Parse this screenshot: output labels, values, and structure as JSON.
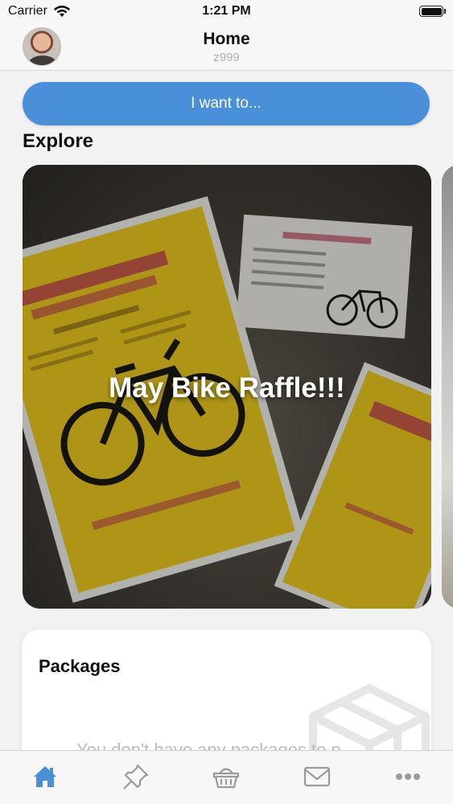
{
  "status_bar": {
    "carrier": "Carrier",
    "time": "1:21 PM"
  },
  "header": {
    "title": "Home",
    "subtitle": "z999"
  },
  "actions": {
    "want_label": "I want to..."
  },
  "explore": {
    "heading": "Explore",
    "cards": [
      {
        "title": "May Bike Raffle!!!"
      }
    ]
  },
  "packages": {
    "title": "Packages",
    "empty_text": "You don't have any packages to p"
  },
  "tabs": [
    {
      "name": "home",
      "icon": "home-icon",
      "active": true
    },
    {
      "name": "pin",
      "icon": "pin-icon",
      "active": false
    },
    {
      "name": "basket",
      "icon": "basket-icon",
      "active": false
    },
    {
      "name": "mail",
      "icon": "mail-icon",
      "active": false
    },
    {
      "name": "more",
      "icon": "more-icon",
      "active": false
    }
  ],
  "colors": {
    "accent": "#4a90d9",
    "active_tab": "#4a90d9",
    "inactive_tab": "#9a9a9a",
    "poster_yellow": "#f2cf1f"
  }
}
